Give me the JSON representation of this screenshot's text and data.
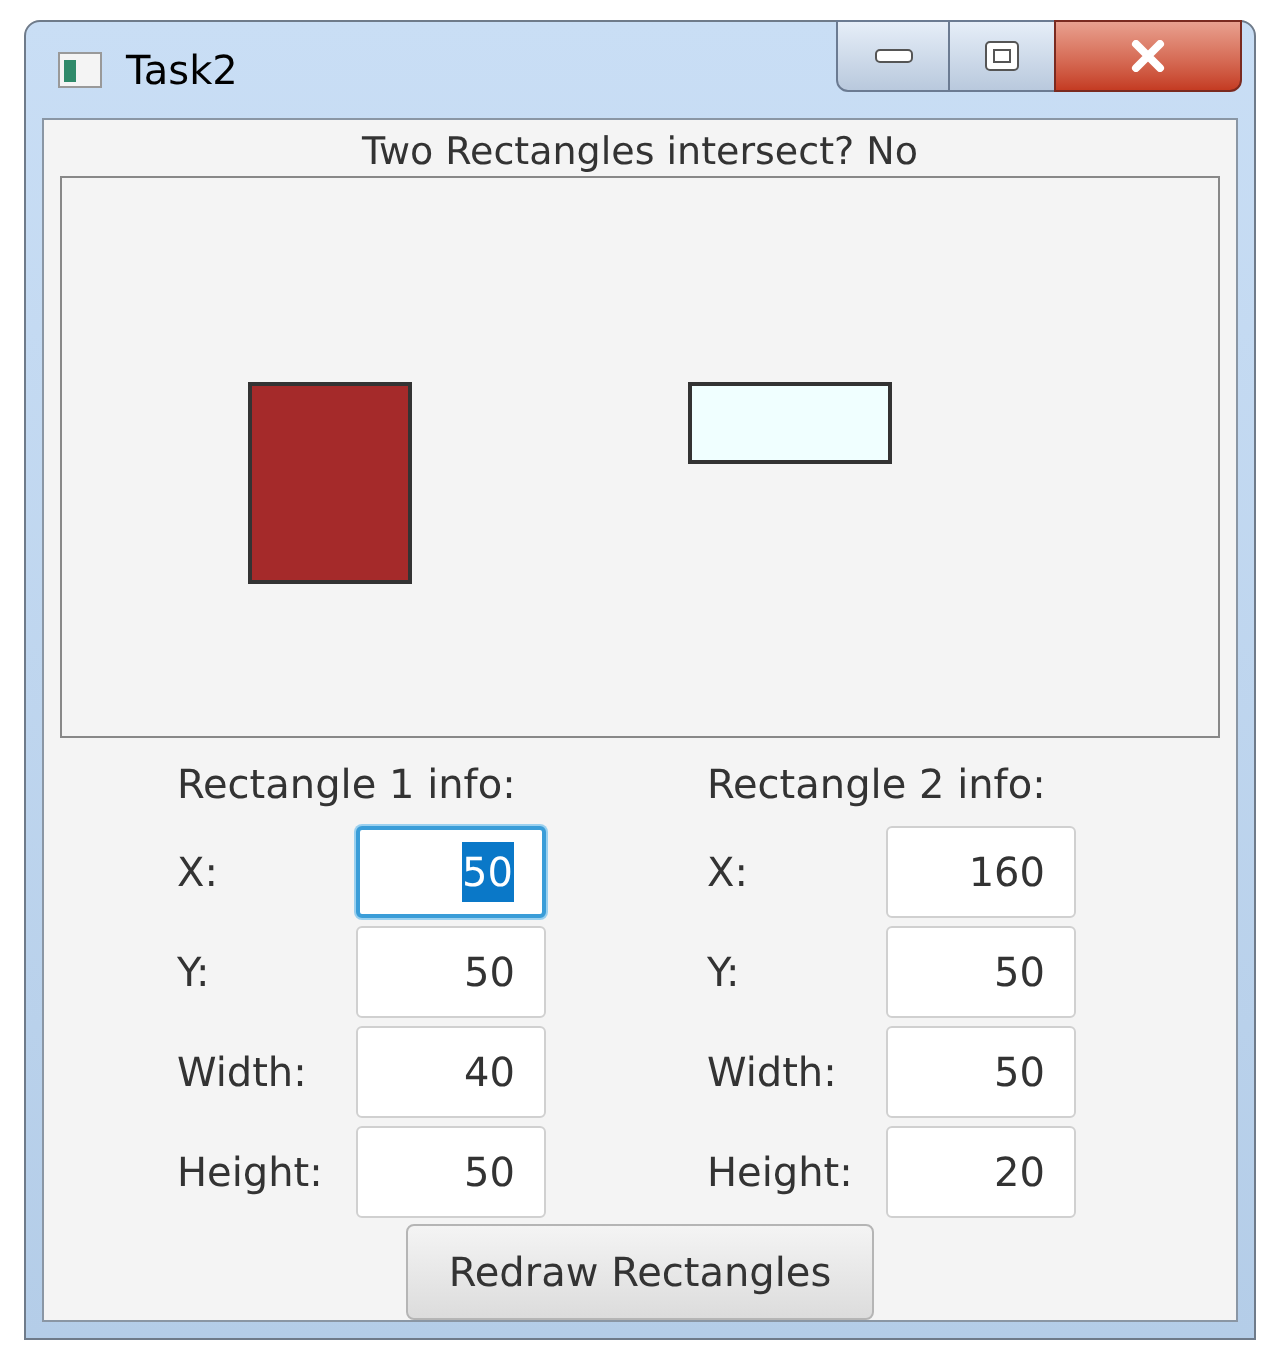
{
  "window": {
    "title": "Task2"
  },
  "status": "Two Rectangles intersect? No",
  "rectangles": [
    {
      "color": "#a52a2a"
    },
    {
      "color": "#f0ffff"
    }
  ],
  "panels": [
    {
      "heading": "Rectangle 1 info:",
      "fields": [
        {
          "label": "X:",
          "value": "50",
          "focused": true
        },
        {
          "label": "Y:",
          "value": "50",
          "focused": false
        },
        {
          "label": "Width:",
          "value": "40",
          "focused": false
        },
        {
          "label": "Height:",
          "value": "50",
          "focused": false
        }
      ]
    },
    {
      "heading": "Rectangle 2 info:",
      "fields": [
        {
          "label": "X:",
          "value": "160",
          "focused": false
        },
        {
          "label": "Y:",
          "value": "50",
          "focused": false
        },
        {
          "label": "Width:",
          "value": "50",
          "focused": false
        },
        {
          "label": "Height:",
          "value": "20",
          "focused": false
        }
      ]
    }
  ],
  "button": "Redraw Rectangles"
}
